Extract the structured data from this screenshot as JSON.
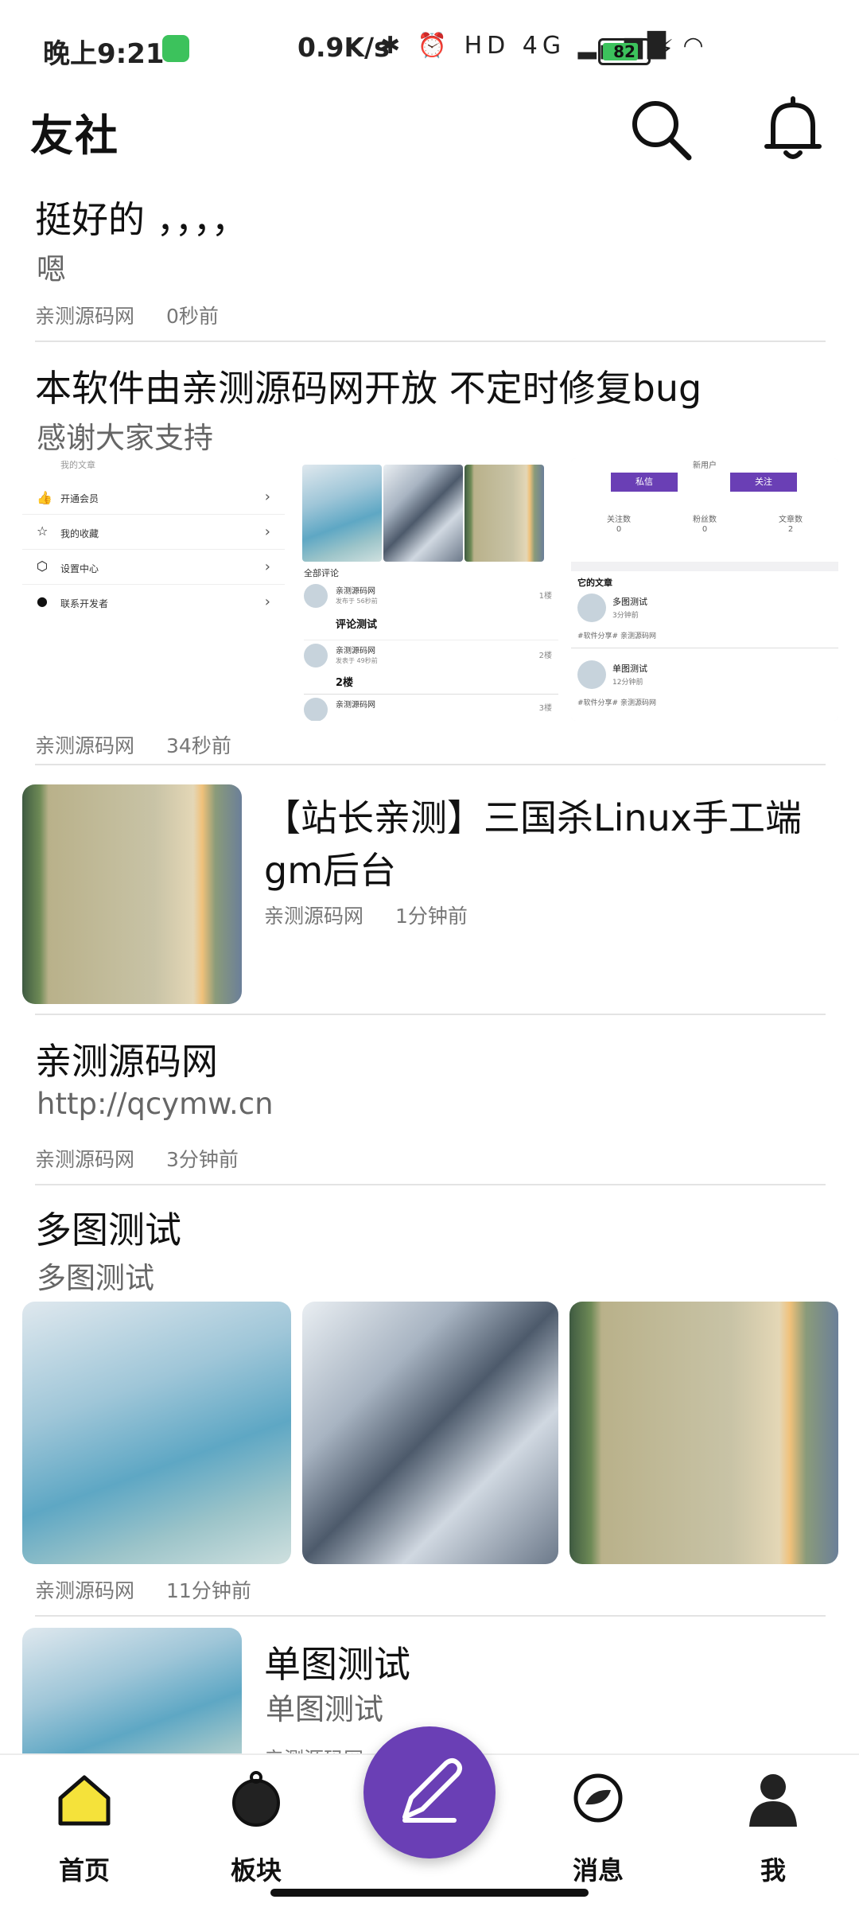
{
  "status_bar": {
    "time": "晚上9:21",
    "network_speed": "0.9K/s",
    "icons": "✱ ⏰ HD 4G ▂▄▆█ ◠",
    "battery": "82"
  },
  "header": {
    "title": "友社"
  },
  "posts": [
    {
      "title": "挺好的 ，，，，",
      "subtitle": "嗯",
      "author": "亲测源码网",
      "time": "0秒前"
    },
    {
      "title": "本软件由亲测源码网开放 不定时修复bug",
      "subtitle": "感谢大家支持",
      "author": "亲测源码网",
      "time": "34秒前",
      "screenshots": {
        "menu": [
          "我的文章",
          "开通会员",
          "我的收藏",
          "设置中心",
          "联系开发者"
        ],
        "comments_header": "全部评论",
        "comments": [
          {
            "name": "亲测源码网",
            "info": "发布于 56秒前",
            "floor": "1楼",
            "text": "评论测试"
          },
          {
            "name": "亲测源码网",
            "info": "发表于 49秒前",
            "floor": "2楼",
            "text": "2楼"
          },
          {
            "name": "亲测源码网",
            "info": "",
            "floor": "3楼",
            "text": ""
          }
        ],
        "profile": {
          "name": "新用户",
          "btn_message": "私信",
          "btn_follow": "关注",
          "stats": [
            {
              "label": "关注数",
              "value": "0"
            },
            {
              "label": "粉丝数",
              "value": "0"
            },
            {
              "label": "文章数",
              "value": "2"
            }
          ],
          "articles_header": "它的文章",
          "articles": [
            {
              "title": "多图测试",
              "time": "3分钟前",
              "tags": "#软件分享# 亲测源码网"
            },
            {
              "title": "单图测试",
              "time": "12分钟前",
              "tags": "#软件分享# 亲测源码网"
            }
          ]
        }
      }
    },
    {
      "title_line1": "【站长亲测】三国杀Linux手工端",
      "title_line2": "gm后台",
      "author": "亲测源码网",
      "time": "1分钟前"
    },
    {
      "title": "亲测源码网",
      "subtitle": "http://qcymw.cn",
      "author": "亲测源码网",
      "time": "3分钟前"
    },
    {
      "title": "多图测试",
      "subtitle": "多图测试",
      "author": "亲测源码网",
      "time": "11分钟前"
    },
    {
      "title": "单图测试",
      "subtitle": "单图测试",
      "author": "亲测源码网",
      "time": ""
    }
  ],
  "bottom_nav": [
    {
      "label": "首页",
      "icon": "home-icon"
    },
    {
      "label": "板块",
      "icon": "board-icon"
    },
    {
      "label": "消息",
      "icon": "message-icon"
    },
    {
      "label": "我",
      "icon": "person-icon"
    }
  ],
  "fab": {
    "icon": "pencil-icon"
  },
  "colors": {
    "accent": "#6a3fb5",
    "home_active": "#f5e23a",
    "battery": "#3cc25c",
    "text_muted": "#777777"
  }
}
